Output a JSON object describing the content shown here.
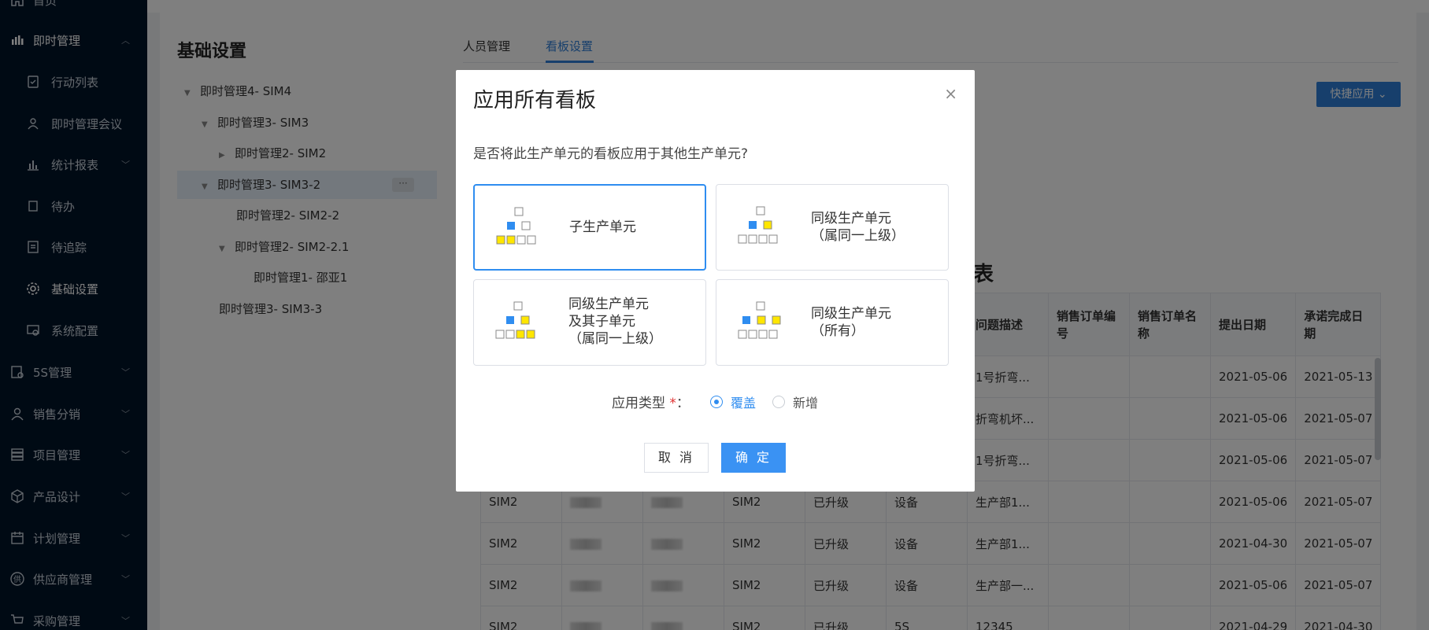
{
  "sidebar": {
    "items": [
      {
        "label": "首页",
        "icon": "home-icon"
      },
      {
        "label": "即时管理",
        "icon": "bar-chart-icon"
      },
      {
        "label": "行动列表",
        "icon": "action-list-icon"
      },
      {
        "label": "即时管理会议",
        "icon": "meeting-icon"
      },
      {
        "label": "统计报表",
        "icon": "report-icon"
      },
      {
        "label": "待办",
        "icon": "todo-icon"
      },
      {
        "label": "待追踪",
        "icon": "track-icon"
      },
      {
        "label": "基础设置",
        "icon": "gear-icon"
      },
      {
        "label": "系统配置",
        "icon": "system-config-icon"
      },
      {
        "label": "5S管理",
        "icon": "5s-icon"
      },
      {
        "label": "销售分销",
        "icon": "user-icon"
      },
      {
        "label": "项目管理",
        "icon": "project-icon"
      },
      {
        "label": "产品设计",
        "icon": "cube-icon"
      },
      {
        "label": "计划管理",
        "icon": "calendar-icon"
      },
      {
        "label": "供应商管理",
        "icon": "supplier-icon"
      },
      {
        "label": "采购管理",
        "icon": "cart-icon"
      }
    ]
  },
  "page": {
    "title": "基础设置",
    "tabs": [
      "人员管理",
      "看板设置"
    ],
    "quick_apply": "快捷应用",
    "table_title_tail": "表"
  },
  "tree": {
    "nodes": [
      "即时管理4- SIM4",
      "即时管理3- SIM3",
      "即时管理2- SIM2",
      "即时管理3- SIM3-2",
      "即时管理2- SIM2-2",
      "即时管理2- SIM2-2.1",
      "即时管理1- 邵亚1",
      "即时管理3- SIM3-3"
    ],
    "more": "···"
  },
  "table": {
    "headers": [
      "",
      "",
      "",
      "",
      "",
      "",
      "问题描述",
      "销售订单编号",
      "销售订单名称",
      "提出日期",
      "承诺完成日期"
    ],
    "rows": [
      [
        "",
        "",
        "",
        "",
        "",
        "",
        "1号折弯...",
        "",
        "",
        "2021-05-06",
        "2021-05-13"
      ],
      [
        "",
        "",
        "",
        "",
        "",
        "",
        "折弯机坏...",
        "",
        "",
        "2021-05-06",
        "2021-05-07"
      ],
      [
        "",
        "",
        "",
        "",
        "",
        "",
        "1号折弯...",
        "",
        "",
        "2021-05-06",
        "2021-05-07"
      ],
      [
        "SIM2",
        "",
        "",
        "SIM2",
        "已升级",
        "设备",
        "生产部1...",
        "",
        "",
        "2021-05-06",
        "2021-05-07"
      ],
      [
        "SIM2",
        "",
        "",
        "SIM2",
        "已升级",
        "设备",
        "生产部1...",
        "",
        "",
        "2021-04-30",
        "2021-05-07"
      ],
      [
        "SIM2",
        "",
        "",
        "SIM2",
        "已升级",
        "设备",
        "生产部一...",
        "",
        "",
        "2021-05-06",
        "2021-05-07"
      ],
      [
        "SIM2",
        "",
        "",
        "SIM2",
        "已升级",
        "5S",
        "12345",
        "",
        "",
        "2021-04-29",
        "2021-04-30"
      ]
    ]
  },
  "modal": {
    "title": "应用所有看板",
    "close": "×",
    "question": "是否将此生产单元的看板应用于其他生产单元?",
    "options": [
      {
        "lines": [
          "子生产单元"
        ]
      },
      {
        "lines": [
          "同级生产单元",
          "（属同一上级）"
        ]
      },
      {
        "lines": [
          "同级生产单元",
          "及其子单元",
          "（属同一上级）"
        ]
      },
      {
        "lines": [
          "同级生产单元",
          "（所有）"
        ]
      }
    ],
    "apply_type_label": "应用类型",
    "required_mark": "*",
    "apply_type_colon": "：",
    "radio_overwrite": "覆盖",
    "radio_add": "新增",
    "cancel": "取 消",
    "confirm": "确 定"
  },
  "colors": {
    "primary": "#2f8df0",
    "sidebar_bg": "#001529",
    "highlight_yellow": "#ffe600",
    "diagram_blue": "#2f8df0"
  }
}
